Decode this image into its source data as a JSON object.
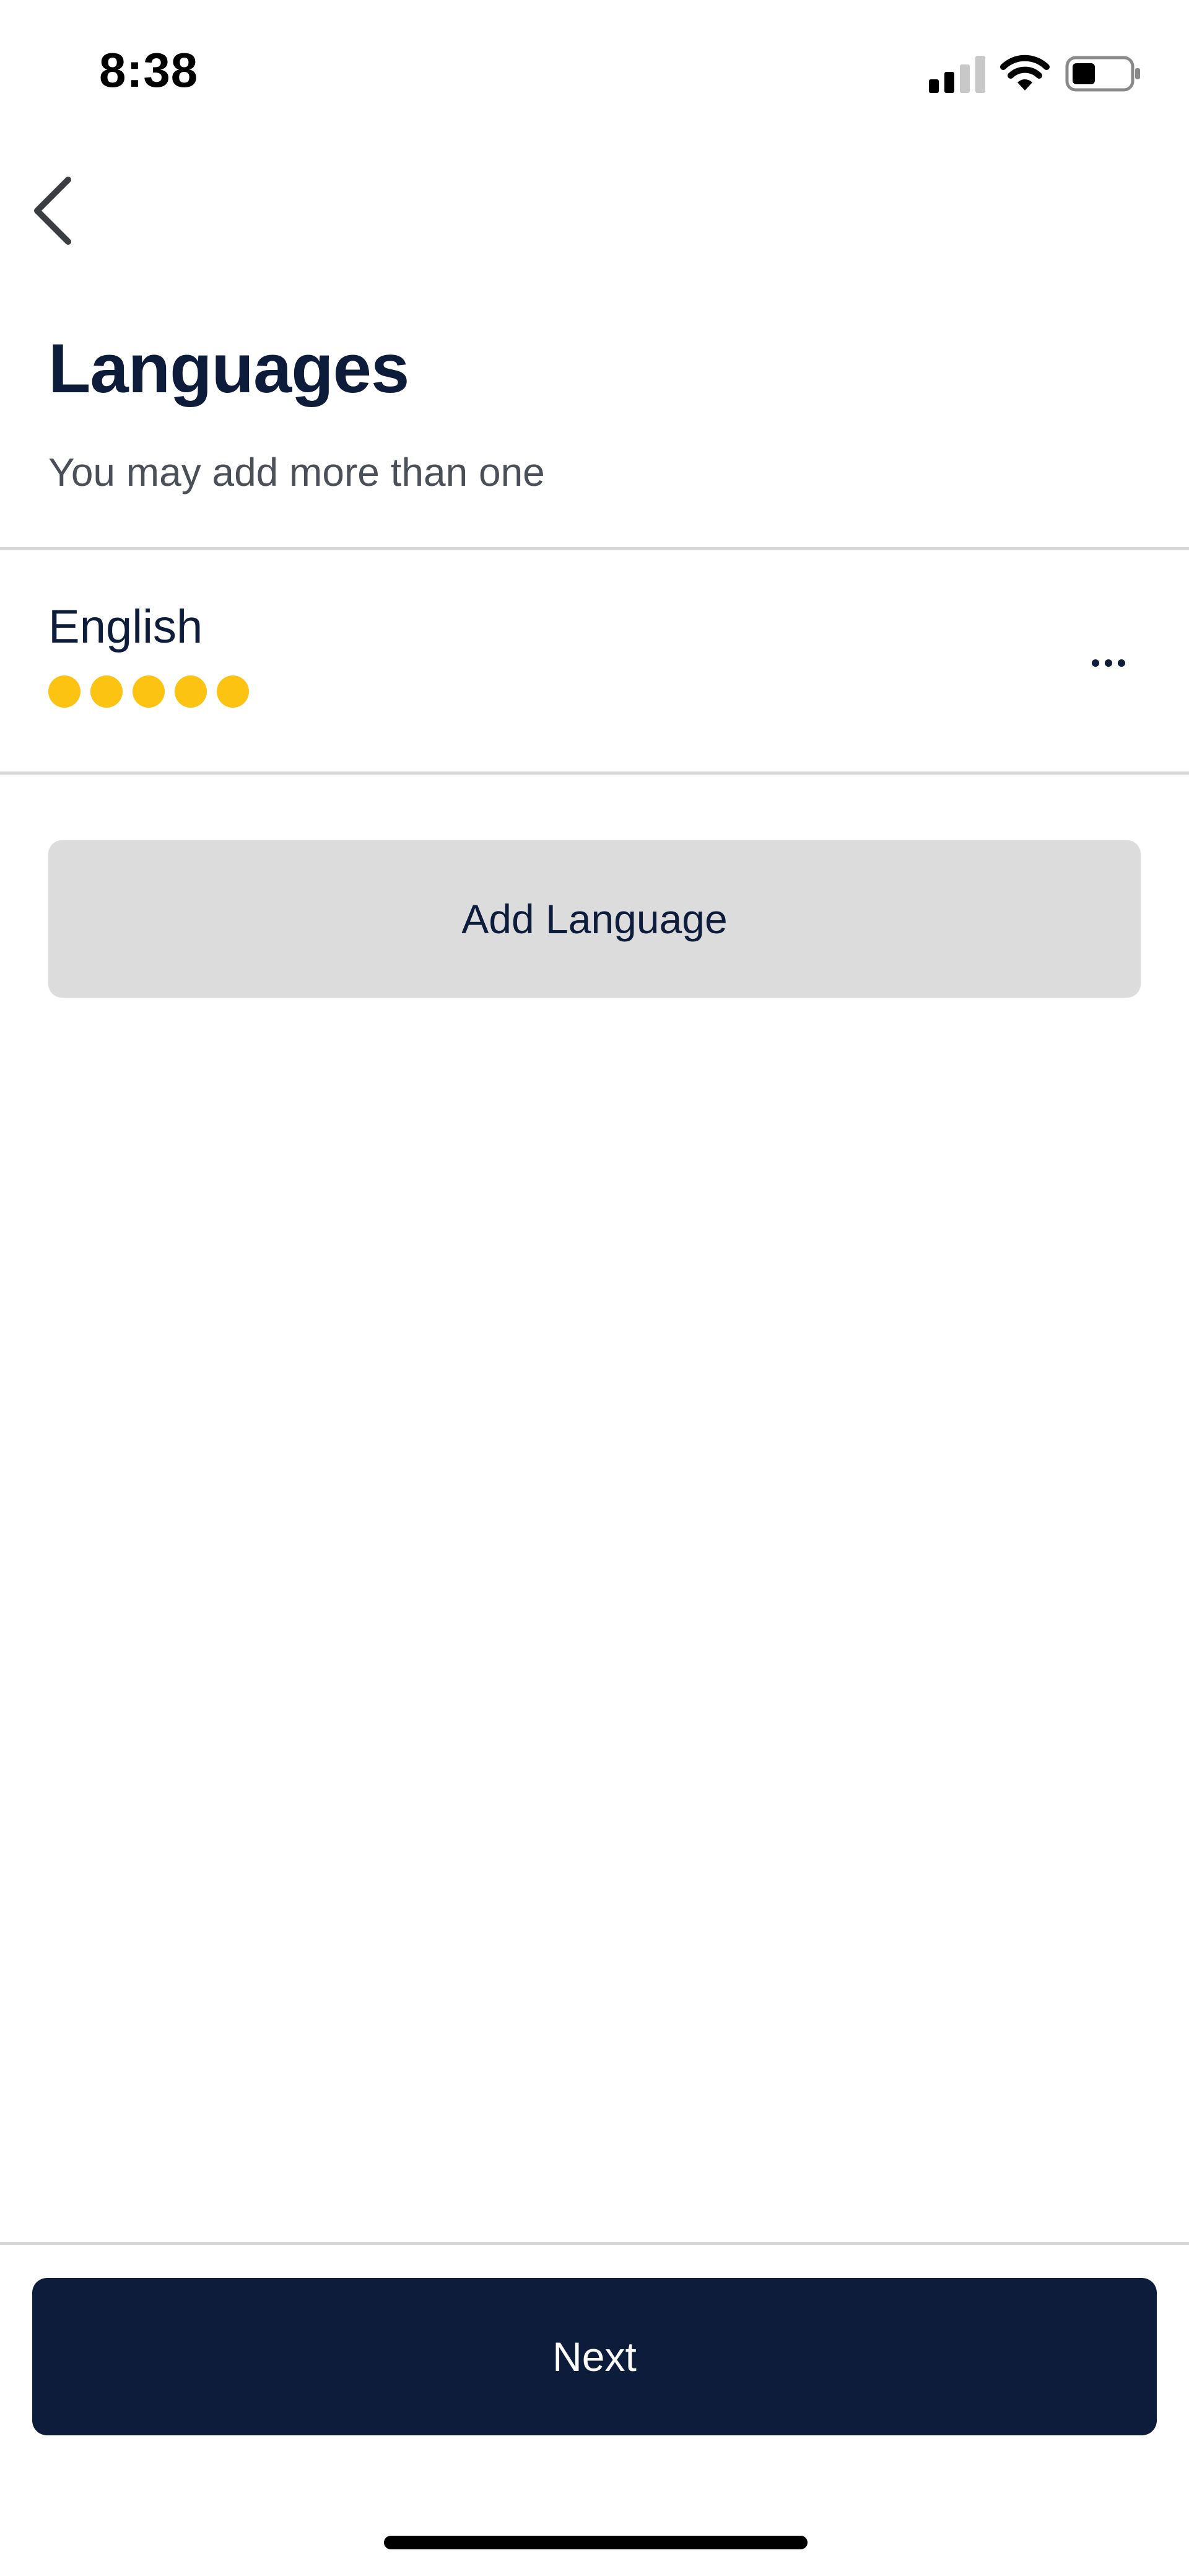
{
  "status_bar": {
    "time": "8:38",
    "icons": [
      "signal-icon",
      "wifi-icon",
      "battery-icon"
    ]
  },
  "nav": {
    "back_icon": "chevron-left-icon"
  },
  "header": {
    "title": "Languages",
    "subtitle": "You may add more than one"
  },
  "languages": [
    {
      "name": "English",
      "proficiency_filled": 5,
      "proficiency_max": 5,
      "more_icon": "more-horizontal-icon"
    }
  ],
  "actions": {
    "add_language_label": "Add Language",
    "next_label": "Next"
  },
  "colors": {
    "primary": "#0d1c3a",
    "accent": "#fcc312",
    "secondary_button": "#dcdcdc",
    "divider": "#d7d7d9",
    "subtitle_text": "#4b4f58"
  }
}
